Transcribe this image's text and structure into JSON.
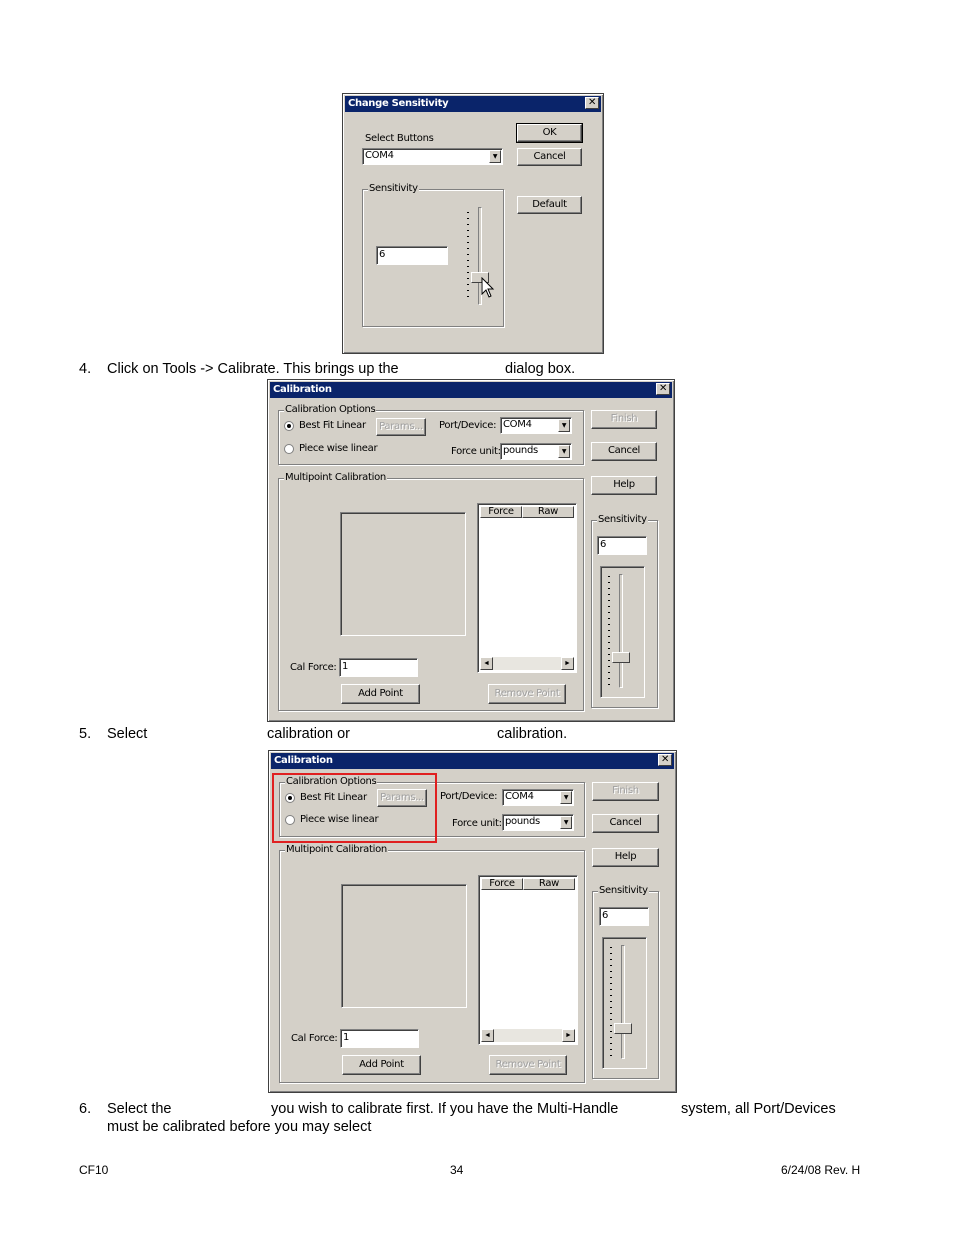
{
  "sensitivity_dialog": {
    "title": "Change Sensitivity",
    "close_glyph": "✕",
    "select_buttons_label": "Select Buttons",
    "select_buttons_value": "COM4",
    "ok_label": "OK",
    "cancel_label": "Cancel",
    "default_label": "Default",
    "sensitivity_group_label": "Sensitivity",
    "sensitivity_value": "6"
  },
  "step4": {
    "number": "4.",
    "text_before": "Click on Tools -> Calibrate. This brings up the",
    "text_after": "dialog box."
  },
  "calibration_dialog": {
    "title": "Calibration",
    "close_glyph": "✕",
    "options_group_label": "Calibration Options",
    "best_fit_linear_label": "Best Fit Linear",
    "piece_wise_linear_label": "Piece wise linear",
    "params_label": "Params...",
    "port_device_label": "Port/Device:",
    "port_device_value": "COM4",
    "force_unit_label": "Force unit:",
    "force_unit_value": "pounds",
    "finish_label": "Finish",
    "cancel_label": "Cancel",
    "help_label": "Help",
    "multipoint_group_label": "Multipoint Calibration",
    "col_force": "Force",
    "col_raw": "Raw",
    "cal_force_label": "Cal Force:",
    "cal_force_value": "1",
    "add_point_label": "Add Point",
    "remove_point_label": "Remove Point",
    "sensitivity_group_label": "Sensitivity",
    "sensitivity_value": "6",
    "scroll_left": "◄",
    "scroll_right": "►",
    "combo_arrow": "▼"
  },
  "step5": {
    "number": "5.",
    "text_select": "Select",
    "text_middle": "calibration or",
    "text_end": "calibration."
  },
  "step6": {
    "number": "6.",
    "line1_a": "Select the",
    "line1_b": "you wish to calibrate first. If you have the Multi-Handle",
    "line1_c": "system, all Port/Devices",
    "line2": "must be calibrated before you may select"
  },
  "footer": {
    "left": "CF10",
    "center": "34",
    "right": "6/24/08 Rev. H"
  },
  "colors": {
    "title_bar": "#0a246a",
    "dialog_face": "#d4d0c8",
    "highlight_box": "#e02020"
  }
}
